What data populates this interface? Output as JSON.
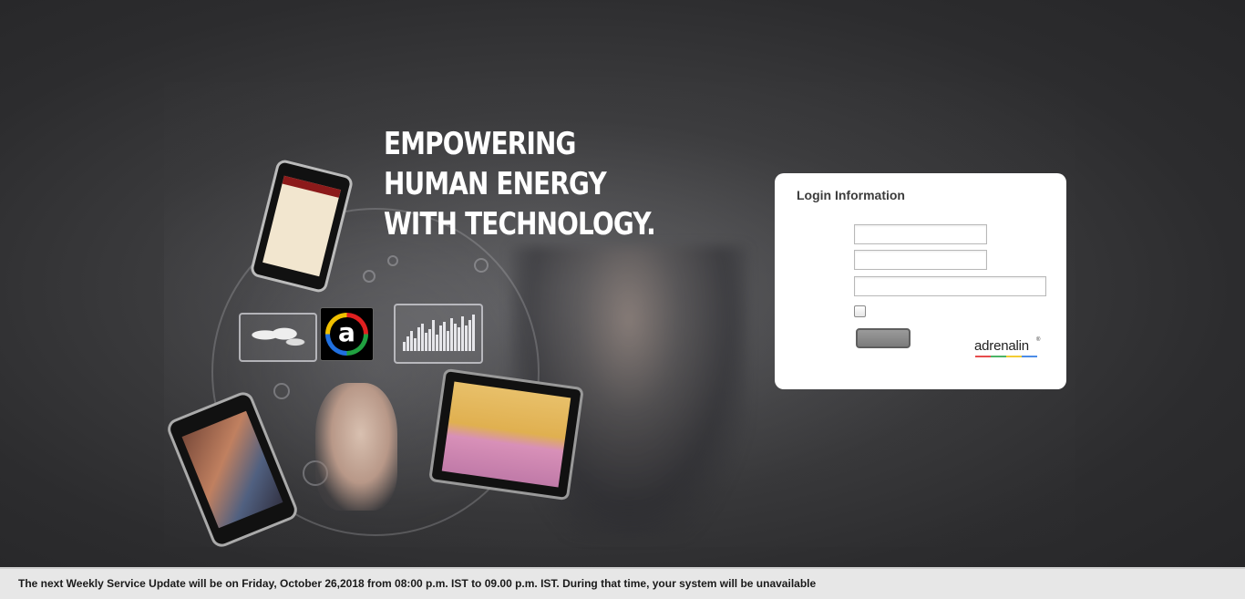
{
  "hero": {
    "tagline": [
      "EMPOWERING",
      "HUMAN ENERGY",
      "WITH TECHNOLOGY."
    ],
    "logo_letter": "a"
  },
  "login": {
    "title": "Login Information",
    "fields": {
      "field1_value": "",
      "field2_value": "",
      "field3_value": ""
    },
    "remember_checked": false,
    "submit_label": "",
    "brand": "adrenalin",
    "brand_mark": "®",
    "brand_colors": [
      "#e02020",
      "#20a040",
      "#f0c000",
      "#2070e0"
    ]
  },
  "notice": {
    "text": "The next Weekly Service Update will be on Friday, October 26,2018 from 08:00 p.m. IST to 09.00 p.m. IST. During that time, your system will be unavailable"
  },
  "icons": [
    "smartphone-icon",
    "tablet-icon",
    "world-map-icon",
    "bar-chart-icon",
    "adrenalin-logo-icon"
  ]
}
